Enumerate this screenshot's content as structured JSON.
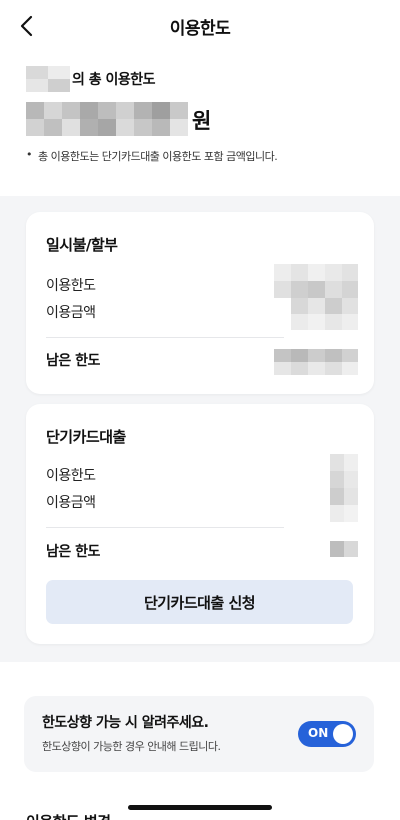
{
  "header": {
    "title": "이용한도",
    "back_icon": "chevron-left-icon"
  },
  "summary": {
    "total_limit_label": "의 총 이용한도",
    "currency_unit": "원",
    "note": "총 이용한도는 단기카드대출 이용한도 포함 금액입니다.",
    "note_bullet": "•"
  },
  "installment_card": {
    "title": "일시불/할부",
    "limit_label": "이용한도",
    "used_label": "이용금액",
    "remaining_label": "남은 한도"
  },
  "cash_card": {
    "title": "단기카드대출",
    "limit_label": "이용한도",
    "used_label": "이용금액",
    "remaining_label": "남은 한도",
    "apply_button": "단기카드대출 신청"
  },
  "notify": {
    "title": "한도상향 가능 시 알려주세요.",
    "subtitle": "한도상향이 가능한 경우 안내해 드립니다.",
    "toggle_label": "ON",
    "toggle_on": true
  },
  "next_section": {
    "title": "이용한도 변경"
  },
  "colors": {
    "accent": "#2662d9",
    "section_bg": "#f4f5f7",
    "button_bg": "#e3eaf6"
  }
}
